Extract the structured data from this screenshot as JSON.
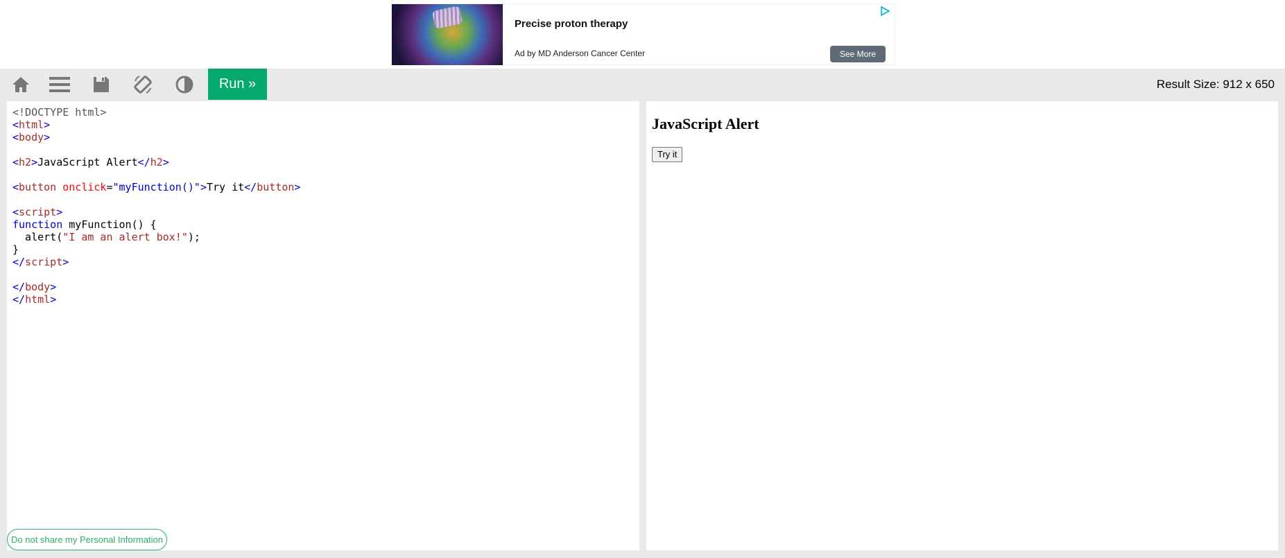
{
  "ad": {
    "title": "Precise proton therapy",
    "by": "Ad by MD Anderson Cancer Center",
    "cta": "See More"
  },
  "toolbar": {
    "icons": [
      "home-icon",
      "menu-icon",
      "save-icon",
      "rotate-icon",
      "contrast-icon"
    ],
    "run_label": "Run »",
    "result_size": "Result Size: 912 x 650"
  },
  "code_lines": {
    "l1": "<!DOCTYPE html>",
    "l2_tag": "html",
    "l3_tag": "body",
    "l5_tag": "h2",
    "l5_text": "JavaScript Alert",
    "l7_tag": "button",
    "l7_attr": "onclick",
    "l7_val": "\"myFunction()\"",
    "l7_text": "Try it",
    "l9_tag": "script",
    "l10_kw": "function",
    "l10_rest": " myFunction() {",
    "l11_pre": "  alert(",
    "l11_str": "\"I am an alert box!\"",
    "l11_post": ");",
    "l12": "}"
  },
  "result": {
    "heading": "JavaScript Alert",
    "button": "Try it"
  },
  "privacy_label": "Do not share my Personal Information",
  "colors": {
    "run_green": "#04aa6d",
    "toolbar_gray": "#e7e9eb",
    "tag_brown": "#a52a2a",
    "bracket_blue": "#0000cd"
  }
}
